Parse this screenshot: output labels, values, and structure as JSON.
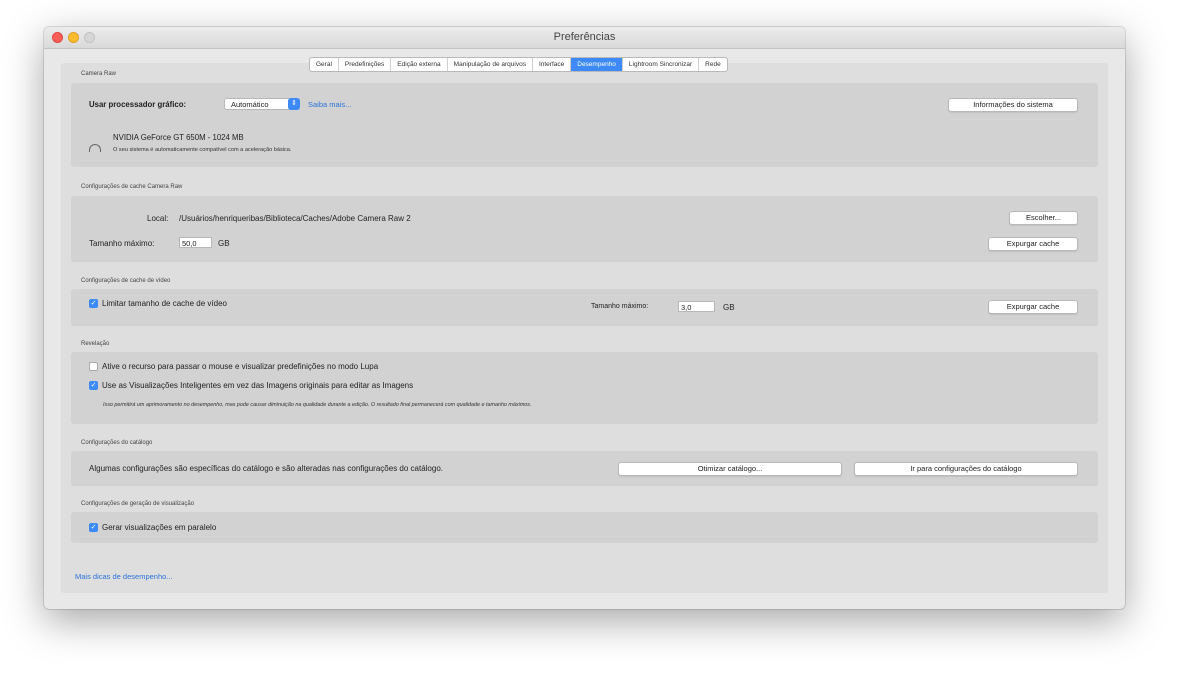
{
  "window": {
    "title": "Preferências"
  },
  "tabs": [
    {
      "label": "Geral"
    },
    {
      "label": "Predefinições"
    },
    {
      "label": "Edição externa"
    },
    {
      "label": "Manipulação de arquivos"
    },
    {
      "label": "Interface"
    },
    {
      "label": "Desempenho"
    },
    {
      "label": "Lightroom Sincronizar"
    },
    {
      "label": "Rede"
    }
  ],
  "camera_raw": {
    "section_title": "Camera Raw",
    "gpu_label": "Usar processador gráfico:",
    "gpu_value": "Automático",
    "learn_more": "Saiba mais...",
    "sysinfo_button": "Informações do sistema",
    "gpu_name": "NVIDIA GeForce GT 650M - 1024 MB",
    "gpu_status": "O seu sistema é automaticamente compatível com a aceleração básica."
  },
  "cache": {
    "section_title": "Configurações de cache Camera Raw",
    "location_label": "Local:",
    "location_value": "/Usuários/henriqueribas/Biblioteca/Caches/Adobe Camera Raw 2",
    "choose_button": "Escolher...",
    "max_size_label": "Tamanho máximo:",
    "max_size_value": "50,0",
    "unit": "GB",
    "purge_button": "Expurgar cache"
  },
  "video_cache": {
    "section_title": "Configurações de cache de vídeo",
    "limit_label": "Limitar tamanho de cache de vídeo",
    "limit_checked": true,
    "max_size_label": "Tamanho máximo:",
    "max_size_value": "3,0",
    "unit": "GB",
    "purge_button": "Expurgar cache"
  },
  "develop": {
    "section_title": "Revelação",
    "hover_label": "Ative o recurso para passar o mouse e visualizar predefinições no modo Lupa",
    "hover_checked": false,
    "smart_label": "Use as Visualizações Inteligentes em vez das Imagens originais para editar as Imagens",
    "smart_checked": true,
    "smart_note": "Isso permitirá um aprimoramento no desempenho, mas pode causar diminuição na qualidade durante a edição. O resultado final permanecerá com qualidade e tamanho máximos."
  },
  "catalog": {
    "section_title": "Configurações do catálogo",
    "note": "Algumas configurações são específicas do catálogo e são alteradas nas configurações do catálogo.",
    "optimize_button": "Otimizar catálogo...",
    "goto_button": "Ir para configurações do catálogo"
  },
  "preview": {
    "section_title": "Configurações de geração de visualização",
    "parallel_label": "Gerar visualizações em paralelo",
    "parallel_checked": true
  },
  "footer": {
    "tips_link": "Mais dicas de desempenho..."
  }
}
